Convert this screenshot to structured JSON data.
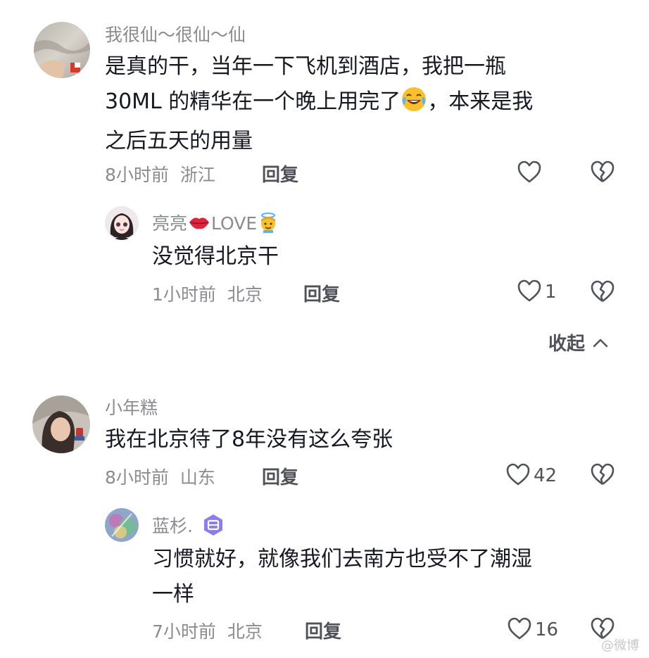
{
  "comments": [
    {
      "username": "我很仙～很仙～仙",
      "text_line1": "是真的干，当年一下飞机到酒店，我把一瓶",
      "text_line2a": "30ML 的精华在一个晚上用完了",
      "text_line2b": "，本来是我",
      "text_line3": "之后五天的用量",
      "time": "8小时前",
      "location": "浙江",
      "reply_label": "回复",
      "likes": "",
      "emoji": "joy-emoji",
      "replies": [
        {
          "username_prefix": "亮亮",
          "username_suffix": "LOVE",
          "text": "没觉得北京干",
          "time": "1小时前",
          "location": "北京",
          "reply_label": "回复",
          "likes": "1",
          "icons": [
            "lips-emoji",
            "angel-emoji"
          ]
        }
      ],
      "collapse_label": "收起"
    },
    {
      "username": "小年糕",
      "text": "我在北京待了8年没有这么夸张",
      "time": "8小时前",
      "location": "山东",
      "reply_label": "回复",
      "likes": "42",
      "replies": [
        {
          "username": "蓝杉.",
          "text_line1": "习惯就好，就像我们去南方也受不了潮湿",
          "text_line2": "一样",
          "time": "7小时前",
          "location": "北京",
          "reply_label": "回复",
          "likes": "16",
          "icons": [
            "level-badge-icon"
          ]
        }
      ]
    }
  ],
  "watermark": "@微博"
}
